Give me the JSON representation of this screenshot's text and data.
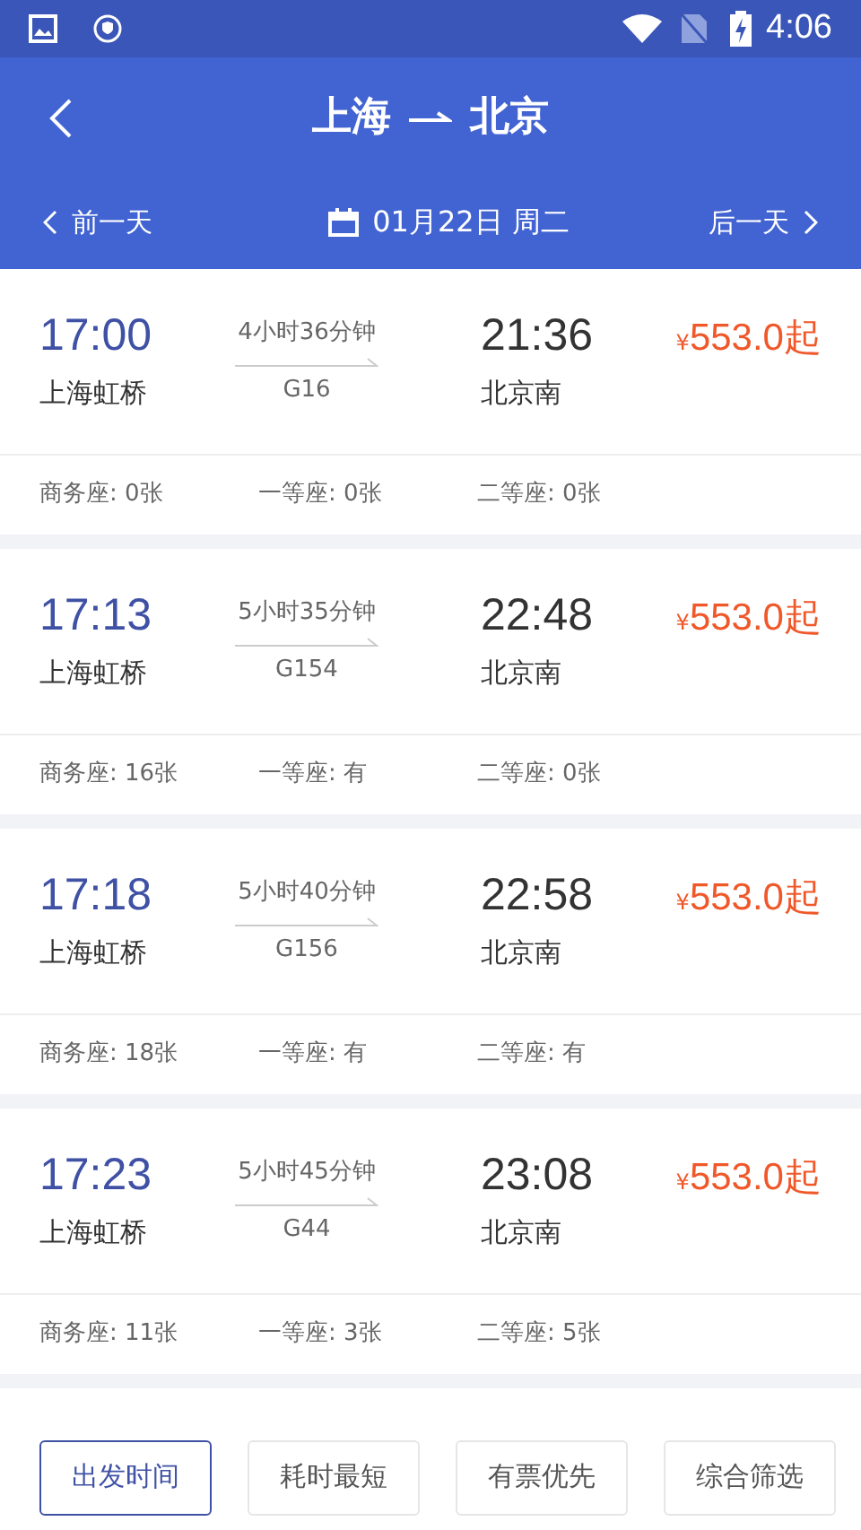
{
  "status_bar": {
    "time": "4:06"
  },
  "header": {
    "from": "上海",
    "to": "北京"
  },
  "date_bar": {
    "prev": "前一天",
    "date": "01月22日 周二",
    "next": "后一天"
  },
  "trains": [
    {
      "depart": "17:00",
      "from_station": "上海虹桥",
      "duration": "4小时36分钟",
      "number": "G16",
      "arrive": "21:36",
      "to_station": "北京南",
      "currency": "¥",
      "price": "553.0起",
      "seats": [
        "商务座: 0张",
        "一等座: 0张",
        "二等座: 0张"
      ]
    },
    {
      "depart": "17:13",
      "from_station": "上海虹桥",
      "duration": "5小时35分钟",
      "number": "G154",
      "arrive": "22:48",
      "to_station": "北京南",
      "currency": "¥",
      "price": "553.0起",
      "seats": [
        "商务座: 16张",
        "一等座: 有",
        "二等座: 0张"
      ]
    },
    {
      "depart": "17:18",
      "from_station": "上海虹桥",
      "duration": "5小时40分钟",
      "number": "G156",
      "arrive": "22:58",
      "to_station": "北京南",
      "currency": "¥",
      "price": "553.0起",
      "seats": [
        "商务座: 18张",
        "一等座: 有",
        "二等座: 有"
      ]
    },
    {
      "depart": "17:23",
      "from_station": "上海虹桥",
      "duration": "5小时45分钟",
      "number": "G44",
      "arrive": "23:08",
      "to_station": "北京南",
      "currency": "¥",
      "price": "553.0起",
      "seats": [
        "商务座: 11张",
        "一等座: 3张",
        "二等座: 5张"
      ]
    }
  ],
  "sort_buttons": [
    {
      "label": "出发时间",
      "selected": true
    },
    {
      "label": "耗时最短",
      "selected": false
    },
    {
      "label": "有票优先",
      "selected": false
    },
    {
      "label": "综合筛选",
      "selected": false
    }
  ]
}
